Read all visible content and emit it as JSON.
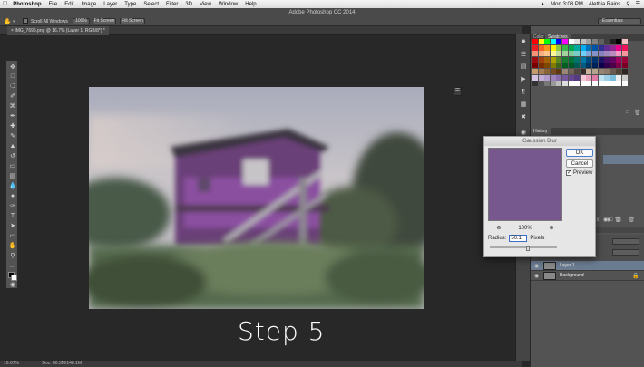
{
  "menubar": {
    "items": [
      "Photoshop",
      "File",
      "Edit",
      "Image",
      "Layer",
      "Type",
      "Select",
      "Filter",
      "3D",
      "View",
      "Window",
      "Help"
    ],
    "clock": "Mon 3:03 PM",
    "user": "Alethia Rains"
  },
  "optionsbar": {
    "window_title": "Adobe Photoshop CC 2014",
    "scroll_all_label": "Scroll All Windows",
    "zoom_btn": "100%",
    "fit_btn": "Fit Screen",
    "fill_btn": "Fill Screen",
    "workspace": "Essentials"
  },
  "document": {
    "tab_title": "IMG_7696.png @ 16.7% (Layer 1, RGB/8*) *",
    "caption": "Step 5"
  },
  "status": {
    "zoom": "16.67%",
    "doc": "Doc: 80.3M/148.1M"
  },
  "panels": {
    "color_tab": "Color",
    "swatches_tab": "Swatches",
    "history_tab": "History",
    "layers": [
      {
        "name": "Layer 1"
      },
      {
        "name": "Background"
      }
    ]
  },
  "dialog": {
    "title": "Gaussian Blur",
    "ok": "OK",
    "cancel": "Cancel",
    "preview_label": "Preview",
    "zoom_value": "100%",
    "radius_label": "Radius:",
    "radius_value": "50.1",
    "radius_unit": "Pixels"
  },
  "colors": {
    "preview": "#77588e"
  }
}
